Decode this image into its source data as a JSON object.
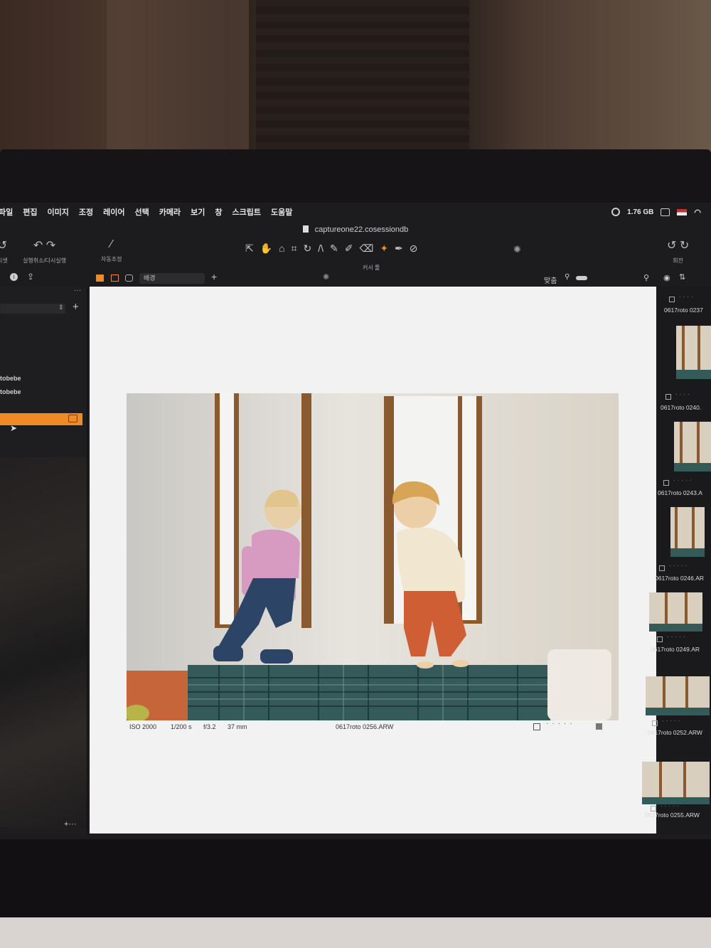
{
  "menubar": {
    "items": [
      "파일",
      "편집",
      "이미지",
      "조정",
      "레이어",
      "선택",
      "카메라",
      "보기",
      "창",
      "스크립트",
      "도움말"
    ],
    "memory": "1.76 GB"
  },
  "window": {
    "title": "captureone22.cosessiondb"
  },
  "toolbar": {
    "reset_label": "리셋",
    "undo_redo_label": "실행취소/다시실행",
    "auto_adjust_label": "자동조정",
    "cursor_tools_label": "커서 툴",
    "rotate_label": "회전"
  },
  "viewer_bar": {
    "background_select": "배경",
    "fit_label": "맞춤"
  },
  "left_panel": {
    "items": [
      "tobebe",
      "tobebe"
    ]
  },
  "viewer": {
    "iso": "ISO 2000",
    "shutter": "1/200 s",
    "aperture": "f/3.2",
    "focal_length": "37 mm",
    "filename": "0617roto 0256.ARW"
  },
  "filmstrip": {
    "thumbnails": [
      "0617roto 0237",
      "0617roto 0240.",
      "0617roto 0243.A",
      "0617roto 0246.AR",
      "0617roto 0249.AR",
      "0617roto 0252.ARW",
      "0617roto 0255.ARW"
    ]
  },
  "colors": {
    "accent": "#f08a24",
    "panel_bg": "#1e1e20",
    "viewer_bg": "#f2f2f2"
  }
}
